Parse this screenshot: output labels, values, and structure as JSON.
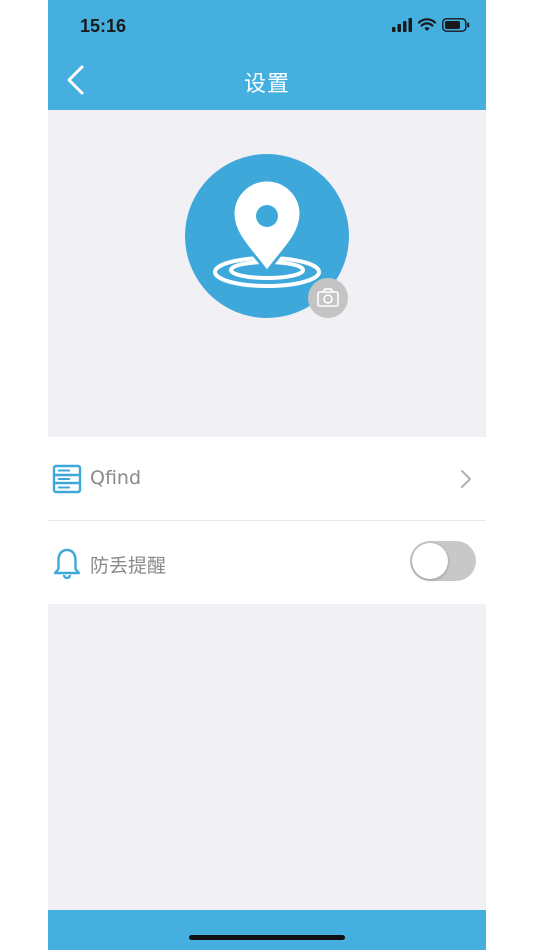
{
  "status_bar": {
    "time": "15:16",
    "icons": [
      "signal-icon",
      "wifi-icon",
      "battery-icon"
    ]
  },
  "nav": {
    "title": "设置",
    "back_icon": "chevron-left-icon"
  },
  "avatar": {
    "icon": "location-pin-icon",
    "badge_icon": "camera-icon"
  },
  "list": {
    "items": [
      {
        "label": "Qfind",
        "icon": "server-icon",
        "accessory": "chevron-right-icon"
      },
      {
        "label": "防丢提醒",
        "icon": "bell-icon",
        "accessory": "toggle",
        "toggle_on": false
      }
    ]
  },
  "colors": {
    "brand": "#45b0e0",
    "avatar": "#3ea8da",
    "background": "#f0f0f5",
    "label": "#8a8a8a"
  }
}
